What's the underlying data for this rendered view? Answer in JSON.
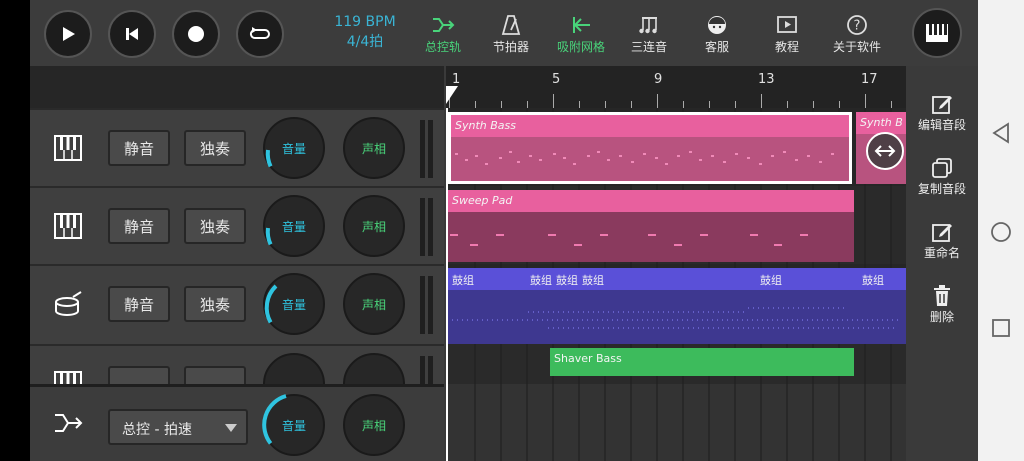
{
  "transport": {
    "play": "play-icon",
    "rewind": "skip-back-icon",
    "record": "record-icon",
    "loop": "loop-icon"
  },
  "tempo": {
    "bpm": "119 BPM",
    "signature": "4/4拍"
  },
  "toolbar": [
    {
      "label": "总控轨",
      "icon": "master-track-icon"
    },
    {
      "label": "节拍器",
      "icon": "metronome-icon"
    },
    {
      "label": "吸附网格",
      "icon": "snap-grid-icon"
    },
    {
      "label": "三连音",
      "icon": "triplet-note-icon"
    },
    {
      "label": "客服",
      "icon": "support-icon"
    },
    {
      "label": "教程",
      "icon": "tutorial-icon"
    },
    {
      "label": "关于软件",
      "icon": "about-icon"
    }
  ],
  "tracks": [
    {
      "instrument": "piano-icon",
      "mute": "静音",
      "solo": "独奏",
      "volume": "音量",
      "pan": "声相",
      "volume_level": 0.35
    },
    {
      "instrument": "piano-icon",
      "mute": "静音",
      "solo": "独奏",
      "volume": "音量",
      "pan": "声相",
      "volume_level": 0.35
    },
    {
      "instrument": "drum-icon",
      "mute": "静音",
      "solo": "独奏",
      "volume": "音量",
      "pan": "声相",
      "volume_level": 0.45
    }
  ],
  "master": {
    "select_value": "总控 - 拍速",
    "volume": "音量",
    "pan": "声相"
  },
  "ruler": [
    "1",
    "5",
    "9",
    "13",
    "17"
  ],
  "clips": {
    "synth_bass": "Synth Bass",
    "synth_bass_2": "Synth B",
    "sweep_pad": "Sweep Pad",
    "drum_labels": [
      "鼓组",
      "鼓组",
      "鼓组",
      "鼓组",
      "鼓组",
      "鼓组"
    ],
    "shaver_bass": "Shaver Bass"
  },
  "side_actions": [
    {
      "label": "编辑音段",
      "icon": "edit-icon"
    },
    {
      "label": "复制音段",
      "icon": "copy-icon"
    },
    {
      "label": "重命名",
      "icon": "rename-icon"
    },
    {
      "label": "删除",
      "icon": "trash-icon"
    }
  ],
  "colors": {
    "accent": "#2fc4e0",
    "green": "#49d37a",
    "pink": "#e8609e",
    "blue": "#5a50d8",
    "clip_green": "#3dbb5c"
  }
}
